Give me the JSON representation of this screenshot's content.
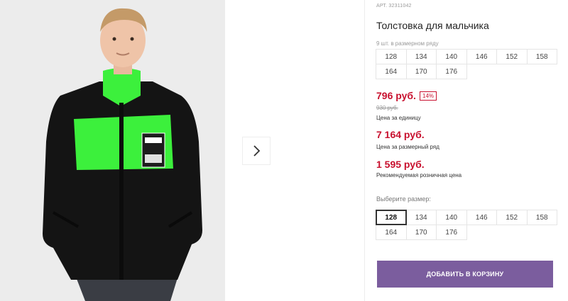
{
  "product": {
    "article": "АРТ. 32311042",
    "title": "Толстовка для мальчика",
    "row_note": "9 шт. в размерном ряду",
    "row_sizes": [
      "128",
      "134",
      "140",
      "146",
      "152",
      "158",
      "164",
      "170",
      "176"
    ],
    "price": "796 руб.",
    "discount": "14%",
    "old_price": "930 руб.",
    "unit_label": "Цена за единицу",
    "row_price": "7 164 руб.",
    "row_label": "Цена за размерный ряд",
    "retail_price": "1 595 руб.",
    "retail_label": "Рекомендуемая розничная цена",
    "choose_label": "Выберите размер:",
    "select_sizes": [
      "128",
      "134",
      "140",
      "146",
      "152",
      "158",
      "164",
      "170",
      "176"
    ],
    "selected_size": "128",
    "cart_button": "ДОБАВИТЬ В КОРЗИНУ"
  },
  "colors": {
    "price_red": "#c8102e",
    "button_purple": "#7b5d9e",
    "jacket_green": "#3cf03c"
  },
  "icons": {
    "next": "chevron-right-icon"
  }
}
